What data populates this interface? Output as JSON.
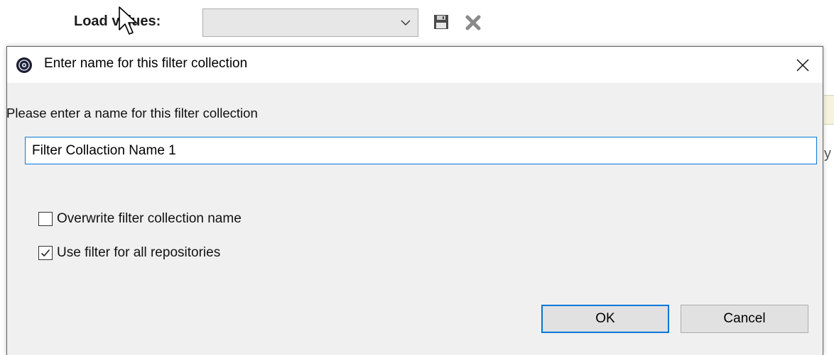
{
  "toolbar": {
    "load_label": "Load values:",
    "load_select_value": "",
    "save_icon": "floppy-disk-icon",
    "delete_icon": "x-delete-icon"
  },
  "dialog": {
    "title": "Enter name for this filter collection",
    "prompt": "Please enter a name for this filter collection",
    "name_value": "Filter Collaction Name 1",
    "options": [
      {
        "label": "Overwrite filter collection name",
        "checked": false
      },
      {
        "label": "Use filter for all repositories",
        "checked": true
      }
    ],
    "ok_label": "OK",
    "cancel_label": "Cancel"
  },
  "background": {
    "partial_glyph": "y"
  },
  "colors": {
    "accent": "#0078d7",
    "dialog_bg": "#f0f0f0",
    "button_bg": "#e1e1e1",
    "icon_gray": "#6e6e6e"
  }
}
